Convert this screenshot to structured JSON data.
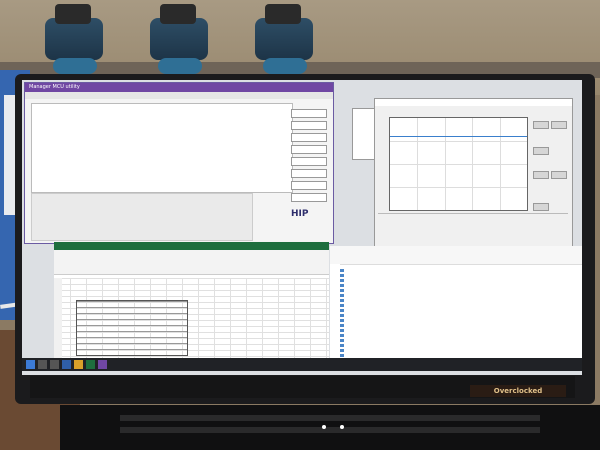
{
  "scene": {
    "app1_title": "Manager MCU utility",
    "logo_text": "HIP",
    "brand_text": "Overclocked"
  },
  "colors": {
    "title_purple": "#7047a3",
    "excel_green": "#1e6e3e",
    "trace_blue": "#3a7fcc"
  }
}
